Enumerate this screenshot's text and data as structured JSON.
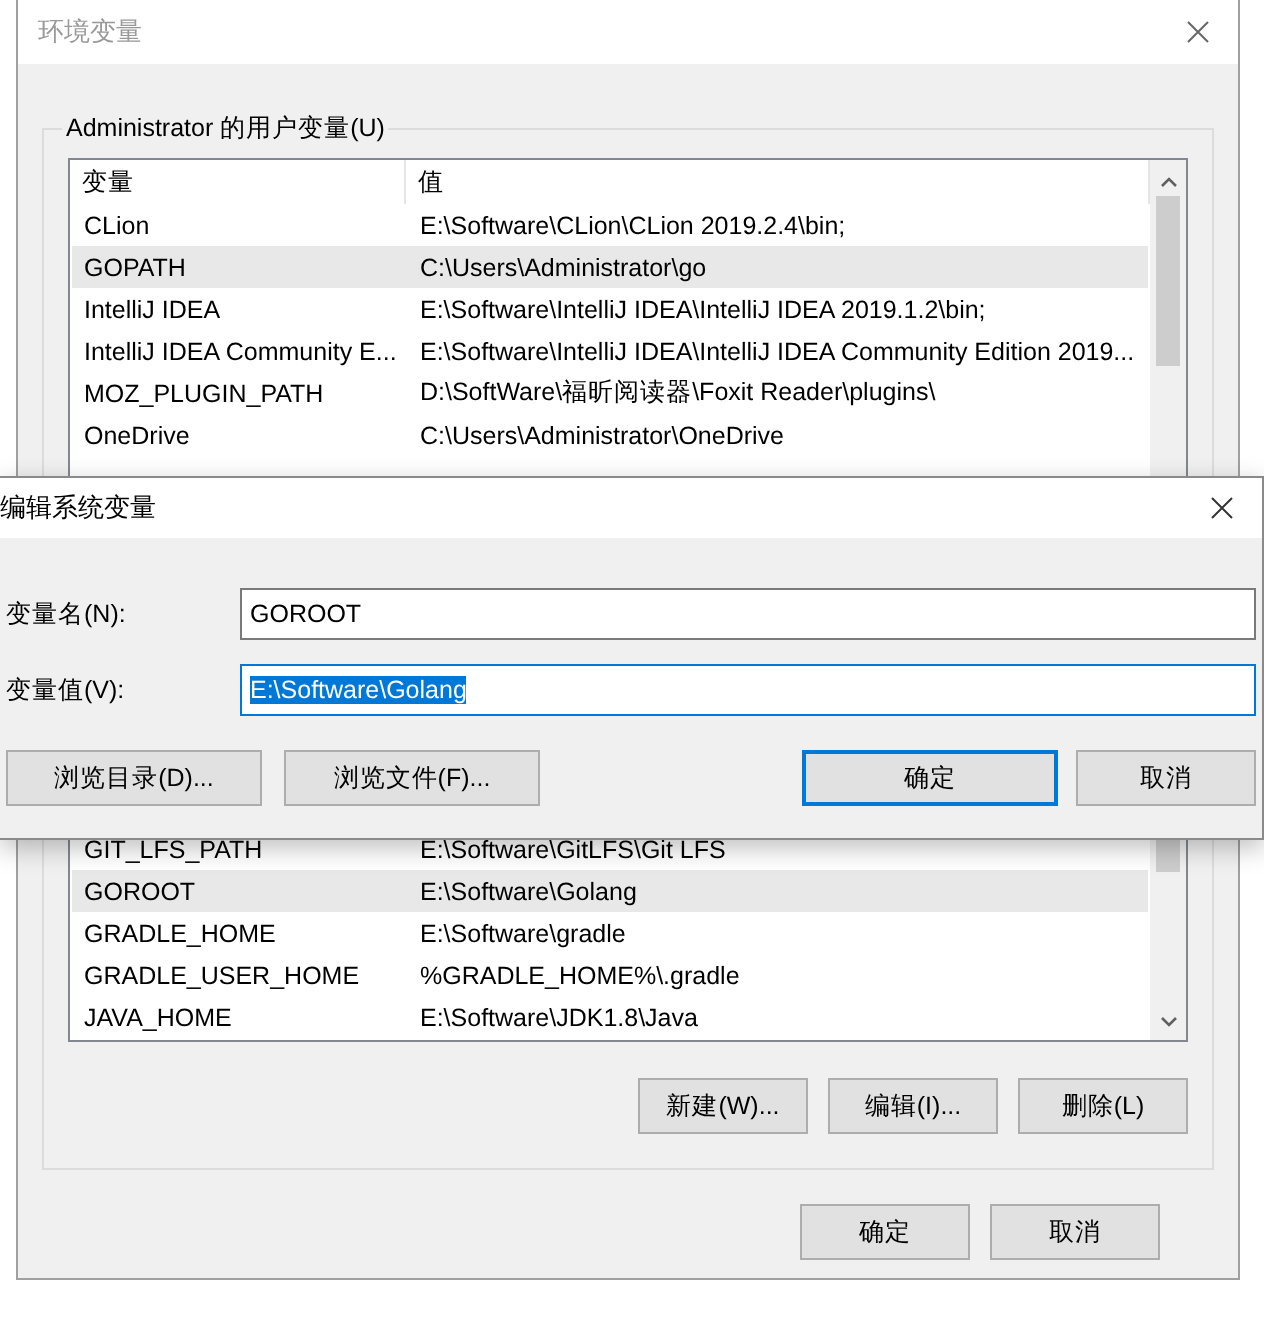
{
  "window": {
    "title": "环境变量"
  },
  "user_variables": {
    "title": "Administrator 的用户变量(U)",
    "columns": [
      "变量",
      "值"
    ],
    "rows": [
      {
        "name": "CLion",
        "value": "E:\\Software\\CLion\\CLion 2019.2.4\\bin;",
        "selected": false
      },
      {
        "name": "GOPATH",
        "value": "C:\\Users\\Administrator\\go",
        "selected": true
      },
      {
        "name": "IntelliJ IDEA",
        "value": "E:\\Software\\IntelliJ IDEA\\IntelliJ IDEA 2019.1.2\\bin;",
        "selected": false
      },
      {
        "name": "IntelliJ IDEA Community E...",
        "value": "E:\\Software\\IntelliJ IDEA\\IntelliJ IDEA Community Edition 2019...",
        "selected": false
      },
      {
        "name": "MOZ_PLUGIN_PATH",
        "value": "D:\\SoftWare\\福昕阅读器\\Foxit Reader\\plugins\\",
        "selected": false
      },
      {
        "name": "OneDrive",
        "value": "C:\\Users\\Administrator\\OneDrive",
        "selected": false
      }
    ]
  },
  "system_variables": {
    "rows": [
      {
        "name": "GIT_LFS_PATH",
        "value": "E:\\Software\\GitLFS\\Git LFS",
        "selected": false
      },
      {
        "name": "GOROOT",
        "value": "E:\\Software\\Golang",
        "selected": true
      },
      {
        "name": "GRADLE_HOME",
        "value": "E:\\Software\\gradle",
        "selected": false
      },
      {
        "name": "GRADLE_USER_HOME",
        "value": "%GRADLE_HOME%\\.gradle",
        "selected": false
      },
      {
        "name": "JAVA_HOME",
        "value": "E:\\Software\\JDK1.8\\Java",
        "selected": false
      }
    ],
    "buttons": [
      "新建(W)...",
      "编辑(I)...",
      "删除(L)"
    ]
  },
  "footer_buttons": [
    {
      "label": "确定",
      "default": false
    },
    {
      "label": "取消",
      "default": false
    }
  ],
  "edit_dialog": {
    "title": "编辑系统变量",
    "fields": [
      {
        "label": "变量名(N):",
        "value": "GOROOT",
        "text_selected": false
      },
      {
        "label": "变量值(V):",
        "value": "E:\\Software\\Golang",
        "text_selected": true
      }
    ],
    "left_buttons": [
      {
        "label": "浏览目录(D)...",
        "default": false
      },
      {
        "label": "浏览文件(F)...",
        "default": false
      }
    ],
    "right_buttons": [
      {
        "label": "确定",
        "default": true
      },
      {
        "label": "取消",
        "default": false
      }
    ]
  }
}
